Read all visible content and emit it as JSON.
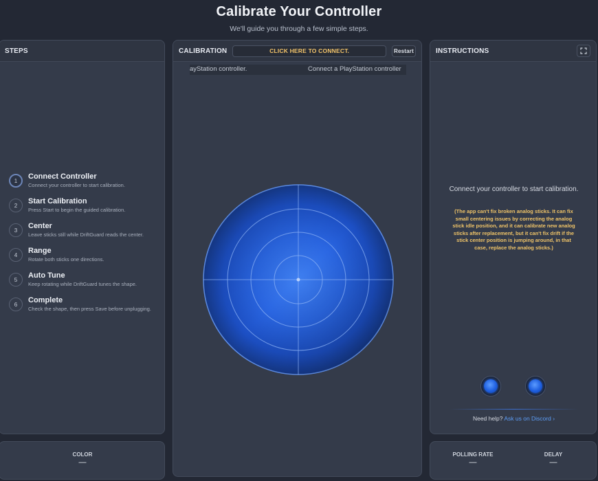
{
  "header": {
    "title": "Calibrate Your Controller",
    "subtitle": "We'll guide you through a few simple steps."
  },
  "steps_panel": {
    "title": "STEPS",
    "items": [
      {
        "num": "1",
        "title": "Connect Controller",
        "desc": "Connect your controller to start calibration."
      },
      {
        "num": "2",
        "title": "Start Calibration",
        "desc": "Press Start to begin the guided calibration."
      },
      {
        "num": "3",
        "title": "Center",
        "desc": "Leave sticks still while DriftGuard reads the center."
      },
      {
        "num": "4",
        "title": "Range",
        "desc": "Rotate both sticks one directions."
      },
      {
        "num": "5",
        "title": "Auto Tune",
        "desc": "Keep rotating while DriftGuard tunes the shape."
      },
      {
        "num": "6",
        "title": "Complete",
        "desc": "Check the shape, then press Save before unplugging."
      }
    ],
    "active_step": 1
  },
  "calibration_panel": {
    "title": "CALIBRATION",
    "connect_label": "CLICK HERE TO CONNECT.",
    "restart_label": "Restart",
    "ticker_left": "ayStation controller.",
    "ticker_right": "Connect a PlayStation controller"
  },
  "instructions_panel": {
    "title": "INSTRUCTIONS",
    "main_text": "Connect your controller to start calibration.",
    "note": "(The app can't fix broken analog sticks. It can fix small centering issues by correcting the analog stick idle position, and it can calibrate new analog sticks after replacement, but it can't fix drift if the stick center position is jumping around, in that case, replace the analog sticks.)",
    "help_prefix": "Need help?",
    "help_link": "Ask us on Discord ›"
  },
  "color_panel": {
    "label": "COLOR",
    "value": "—"
  },
  "stats_panel": {
    "polling_label": "POLLING RATE",
    "polling_value": "—",
    "delay_label": "DELAY",
    "delay_value": "—"
  },
  "colors": {
    "accent": "#f3c46a",
    "link": "#5c9cf5",
    "radar_blue": "#1e5fe0"
  },
  "icons": {
    "expand": "expand-icon"
  }
}
